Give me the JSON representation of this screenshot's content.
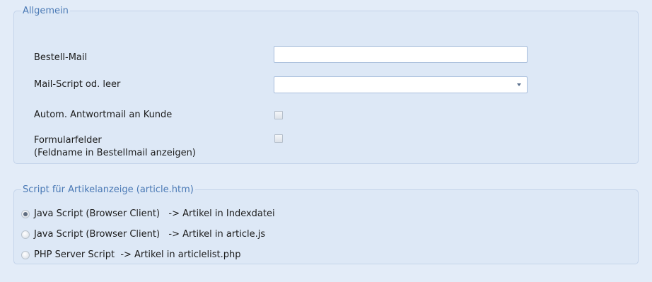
{
  "general": {
    "legend": "Allgemein",
    "order_mail_label": "Bestell-Mail",
    "order_mail_value": "",
    "mail_script_label": "Mail-Script od. leer",
    "mail_script_value": "",
    "auto_reply_label": "Autom. Antwortmail an Kunde",
    "auto_reply_checked": false,
    "form_fields_label_line1": "Formularfelder",
    "form_fields_label_line2": "(Feldname in Bestellmail anzeigen)",
    "form_fields_checked": false
  },
  "article_script": {
    "legend": "Script für Artikelanzeige (article.htm)",
    "options": [
      {
        "label": "Java Script (Browser Client)   -> Artikel in Indexdatei",
        "selected": true
      },
      {
        "label": "Java Script (Browser Client)   -> Artikel in article.js",
        "selected": false
      },
      {
        "label": "PHP Server Script  -> Artikel in articlelist.php",
        "selected": false
      }
    ]
  }
}
